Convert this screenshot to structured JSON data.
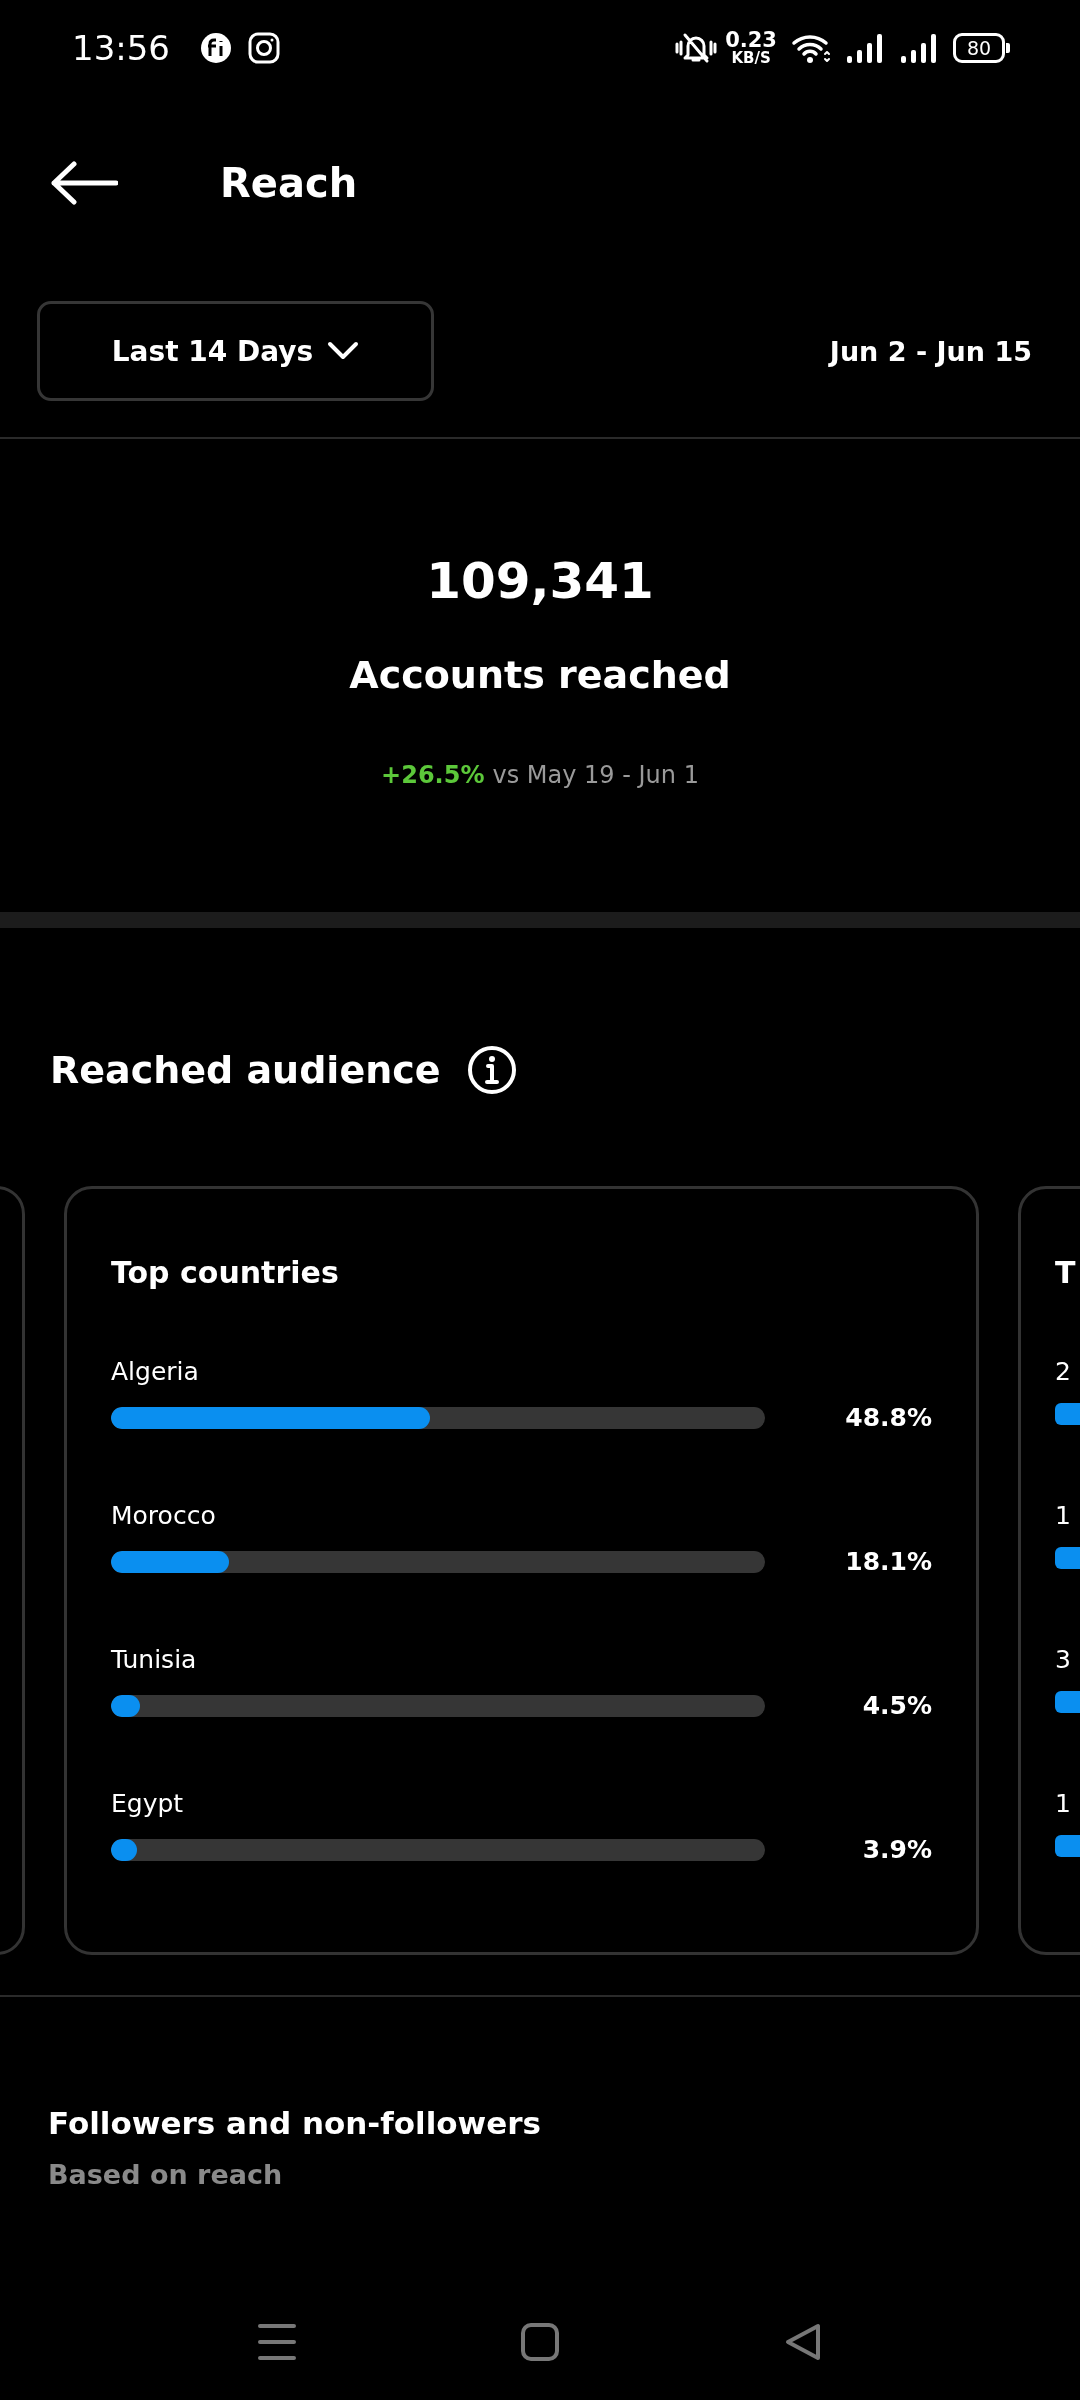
{
  "status_bar": {
    "time": "13:56",
    "net_speed": "0.23",
    "net_unit": "KB/S",
    "battery": "80"
  },
  "header": {
    "title": "Reach"
  },
  "range": {
    "label": "Last 14 Days",
    "dates": "Jun 2 - Jun 15"
  },
  "summary": {
    "value": "109,341",
    "label": "Accounts reached",
    "change": "+26.5%",
    "comparison": "vs May 19 - Jun 1"
  },
  "audience": {
    "title": "Reached audience",
    "card": {
      "title": "Top countries",
      "rows": [
        {
          "label": "Algeria",
          "level": 0.488,
          "value": "48.8%"
        },
        {
          "label": "Morocco",
          "level": 0.181,
          "value": "18.1%"
        },
        {
          "label": "Tunisia",
          "level": 0.045,
          "value": "4.5%"
        },
        {
          "label": "Egypt",
          "level": 0.039,
          "value": "3.9%"
        }
      ]
    },
    "next_card": {
      "title": "T",
      "rows": [
        "2",
        "1",
        "3",
        "1"
      ]
    }
  },
  "followers": {
    "title": "Followers and non-followers",
    "subtitle": "Based on reach"
  }
}
